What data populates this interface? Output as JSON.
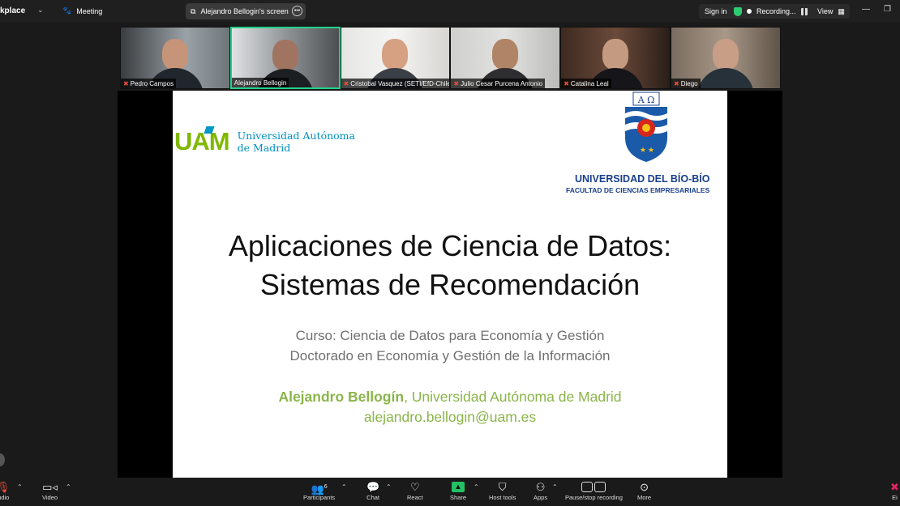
{
  "topbar": {
    "app_name": "kplace",
    "meeting_label": "Meeting",
    "tab_label": "Alejandro Bellogin's screen",
    "sign_in": "Sign in",
    "recording": "Recording...",
    "view": "View"
  },
  "participants": [
    {
      "name": "Pedro Campos",
      "muted": true
    },
    {
      "name": "Alejandro Bellogin",
      "muted": false,
      "active": true
    },
    {
      "name": "Cristobal Vasquez (SETI/EfD-Chile)",
      "muted": true
    },
    {
      "name": "Julio Cesar Purcena Antonio",
      "muted": true
    },
    {
      "name": "Catalina Leal",
      "muted": true
    },
    {
      "name": "Diego",
      "muted": true
    }
  ],
  "slide": {
    "uam_mark": "UAM",
    "uam_line1": "Universidad Autónoma",
    "uam_line2": "de Madrid",
    "crest_letters": "A Ω",
    "ubb_name": "UNIVERSIDAD DEL BÍO-BÍO",
    "ubb_faculty": "FACULTAD DE CIENCIAS EMPRESARIALES",
    "title_line1": "Aplicaciones de Ciencia de Datos:",
    "title_line2": "Sistemas de Recomendación",
    "sub_line1": "Curso: Ciencia de Datos para Economía y Gestión",
    "sub_line2": "Doctorado en Economía y Gestión de la Información",
    "author_name": "Alejandro Bellogín",
    "author_affil": ", Universidad Autónoma de Madrid",
    "author_email": "alejandro.bellogin@uam.es"
  },
  "toolbar": {
    "audio": "udio",
    "video": "Video",
    "participants": "Participants",
    "participants_count": "6",
    "chat": "Chat",
    "react": "React",
    "share": "Share",
    "host_tools": "Host tools",
    "apps": "Apps",
    "pause_recording": "Pause/stop recording",
    "more": "More",
    "end": "Ei"
  }
}
